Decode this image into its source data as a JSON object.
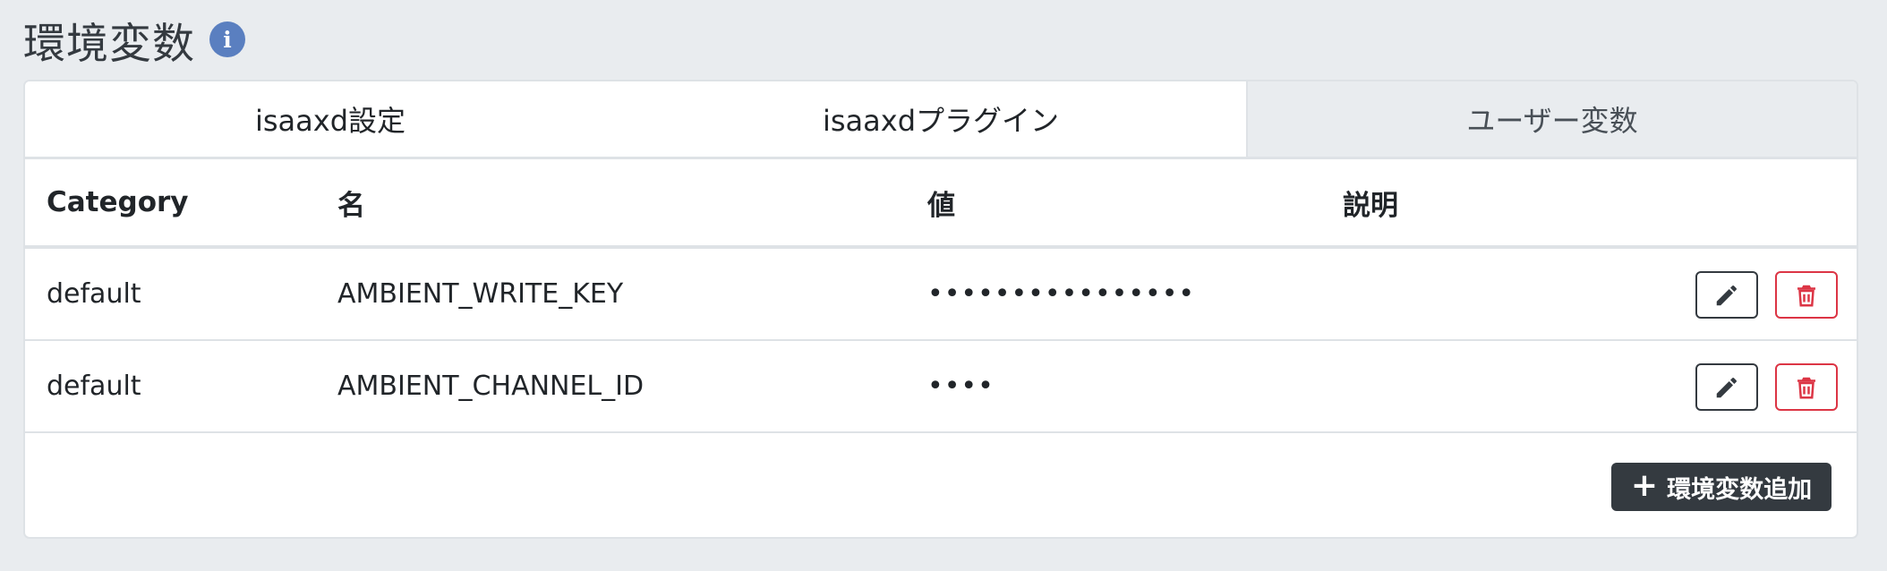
{
  "page": {
    "title": "環境変数",
    "info_icon": "info-circle-icon"
  },
  "tabs": [
    {
      "label": "isaaxd設定",
      "active": false
    },
    {
      "label": "isaaxdプラグイン",
      "active": false
    },
    {
      "label": "ユーザー変数",
      "active": true
    }
  ],
  "table": {
    "headers": {
      "category": "Category",
      "name": "名",
      "value": "値",
      "description": "説明"
    },
    "rows": [
      {
        "category": "default",
        "name": "AMBIENT_WRITE_KEY",
        "value": "••••••••••••••••",
        "description": ""
      },
      {
        "category": "default",
        "name": "AMBIENT_CHANNEL_ID",
        "value": "••••",
        "description": ""
      }
    ]
  },
  "actions": {
    "edit_icon": "pencil-icon",
    "delete_icon": "trash-icon",
    "add_label": "環境変数追加",
    "add_icon": "plus-icon"
  },
  "colors": {
    "dark": "#343a40",
    "danger": "#dc3545",
    "info": "#5a7fc0",
    "background": "#e9ecef"
  }
}
